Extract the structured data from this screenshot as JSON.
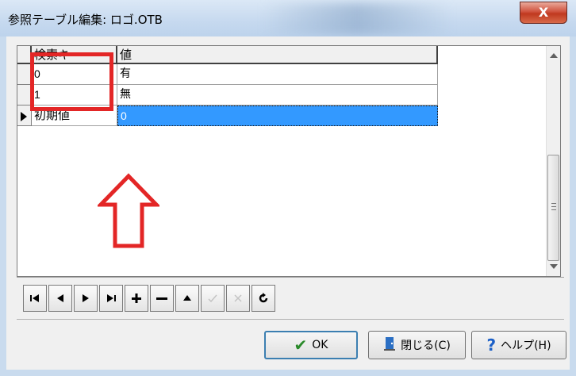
{
  "window": {
    "title": "参照テーブル編集: ロゴ.OTB",
    "close_label": "X"
  },
  "grid": {
    "columns": [
      "検索キー",
      "値"
    ],
    "rows": [
      {
        "key": "0",
        "value": "有"
      },
      {
        "key": "1",
        "value": "無"
      },
      {
        "key": "初期値",
        "value": "0",
        "current": true
      }
    ]
  },
  "navigator": {
    "buttons": [
      {
        "name": "first",
        "glyph": "⏮",
        "enabled": true
      },
      {
        "name": "prior",
        "glyph": "◀",
        "enabled": true
      },
      {
        "name": "next",
        "glyph": "▶",
        "enabled": true
      },
      {
        "name": "last",
        "glyph": "⏭",
        "enabled": true
      },
      {
        "name": "insert",
        "glyph": "+",
        "enabled": true
      },
      {
        "name": "delete",
        "glyph": "−",
        "enabled": true
      },
      {
        "name": "edit",
        "glyph": "▲",
        "enabled": true
      },
      {
        "name": "post",
        "glyph": "✓",
        "enabled": false
      },
      {
        "name": "cancel",
        "glyph": "✕",
        "enabled": false
      },
      {
        "name": "refresh",
        "glyph": "↻",
        "enabled": true
      }
    ]
  },
  "buttons": {
    "ok_label": "OK",
    "close_label": "閉じる(C)",
    "help_label": "ヘルプ(H)"
  },
  "colors": {
    "selection": "#3399ff",
    "annotation": "#e32626"
  }
}
